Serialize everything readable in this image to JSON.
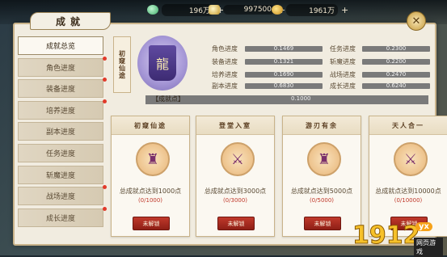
{
  "currencies": [
    {
      "name": "jade",
      "value": "196万"
    },
    {
      "name": "silver",
      "value": "997500"
    },
    {
      "name": "gold",
      "value": "1961万"
    }
  ],
  "panel": {
    "title": "成就",
    "close_icon": "close-icon"
  },
  "sidebar": {
    "items": [
      {
        "label": "成就总览",
        "active": true,
        "dot": false
      },
      {
        "label": "角色进度",
        "active": false,
        "dot": true
      },
      {
        "label": "装备进度",
        "active": false,
        "dot": true
      },
      {
        "label": "培养进度",
        "active": false,
        "dot": true
      },
      {
        "label": "副本进度",
        "active": false,
        "dot": false
      },
      {
        "label": "任务进度",
        "active": false,
        "dot": false
      },
      {
        "label": "斩魔进度",
        "active": false,
        "dot": false
      },
      {
        "label": "战场进度",
        "active": false,
        "dot": true
      },
      {
        "label": "成长进度",
        "active": false,
        "dot": true
      }
    ]
  },
  "overview": {
    "banner": "初窥仙途",
    "stats_left": [
      {
        "label": "角色进度",
        "value": "0.1469"
      },
      {
        "label": "装备进度",
        "value": "0.1321"
      },
      {
        "label": "培养进度",
        "value": "0.1690"
      },
      {
        "label": "副本进度",
        "value": "0.6830"
      }
    ],
    "stats_right": [
      {
        "label": "任务进度",
        "value": "0.2300"
      },
      {
        "label": "斩魔进度",
        "value": "0.2200"
      },
      {
        "label": "战场进度",
        "value": "0.2470"
      },
      {
        "label": "成长进度",
        "value": "0.6240"
      }
    ],
    "points_label": "【成就点】",
    "points_value": "0.1000"
  },
  "cards": [
    {
      "title": "初窥仙途",
      "desc": "总成就点达到1000点",
      "progress": "(0/1000)",
      "button": "未解锁"
    },
    {
      "title": "登堂入室",
      "desc": "总成就点达到3000点",
      "progress": "(0/3000)",
      "button": "未解锁"
    },
    {
      "title": "游刃有余",
      "desc": "总成就点达到5000点",
      "progress": "(0/5000)",
      "button": "未解锁"
    },
    {
      "title": "天人合一",
      "desc": "总成就点达到10000点",
      "progress": "(0/10000)",
      "button": "未解锁"
    }
  ],
  "watermark": {
    "big": "1912",
    "yx": "yx",
    "sub": "网页游戏"
  }
}
